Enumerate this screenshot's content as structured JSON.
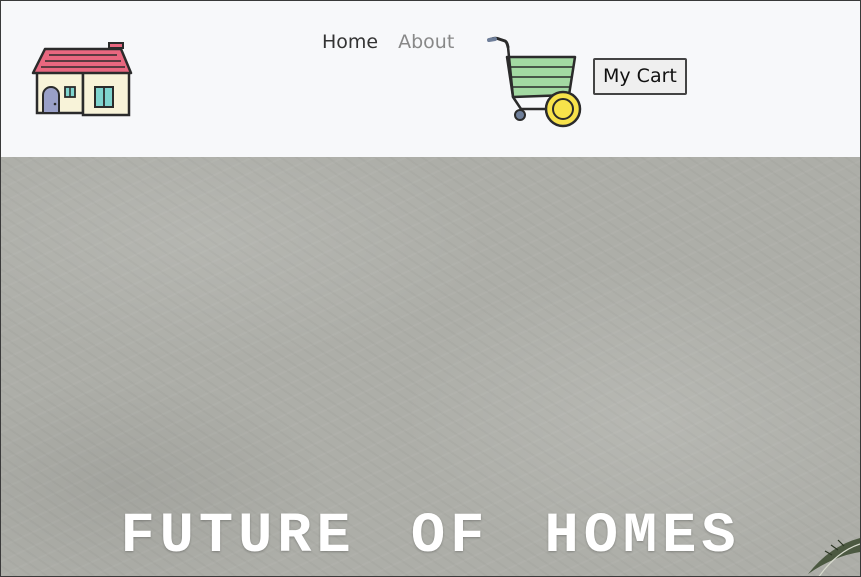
{
  "nav": {
    "links": [
      {
        "label": "Home",
        "active": true
      },
      {
        "label": "About",
        "active": false
      }
    ],
    "cart_button_label": "My Cart",
    "icons": {
      "logo": "house-icon",
      "cart": "shopping-cart-icon"
    }
  },
  "hero": {
    "title": "FUTURE OF HOMES",
    "decoration": "plant-leaf-icon"
  },
  "colors": {
    "navbar_bg": "#f7f8fa",
    "roof": "#e8677f",
    "house_wall": "#f8f3d9",
    "window": "#7fd4cf",
    "cart_basket": "#a3d9a2",
    "cart_wheel": "#f7e24a",
    "hero_bg": "#adaea8"
  }
}
